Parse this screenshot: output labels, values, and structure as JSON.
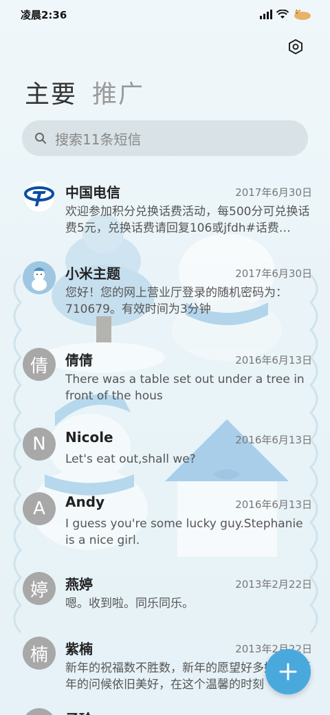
{
  "status_bar": {
    "time": "凌晨2:36"
  },
  "tabs": [
    {
      "label": "主要",
      "active": true
    },
    {
      "label": "推广",
      "active": false
    }
  ],
  "search": {
    "placeholder": "搜索11条短信"
  },
  "conversations": [
    {
      "name": "中国电信",
      "date": "2017年6月30日",
      "preview": "欢迎参加积分兑换话费活动，每500分可兑换话费5元，兑换话费请回复106或jfdh#话费…",
      "avatar_type": "logo",
      "avatar_icon": "china-telecom-logo"
    },
    {
      "name": "小米主题",
      "date": "2017年6月30日",
      "preview": "您好！您的网上营业厅登录的随机密码为：710679。有效时间为3分钟",
      "avatar_type": "image",
      "avatar_icon": "snowman-avatar"
    },
    {
      "name": "倩倩",
      "date": "2016年6月13日",
      "preview": "There was a table set out under a tree in front of the hous",
      "avatar_type": "letter",
      "avatar_letter": "倩"
    },
    {
      "name": "Nicole",
      "date": "2016年6月13日",
      "preview": "Let's eat out,shall we?",
      "avatar_type": "letter",
      "avatar_letter": "N"
    },
    {
      "name": "Andy",
      "date": "2016年6月13日",
      "preview": "I guess you're some lucky guy.Stephanie is a nice girl.",
      "avatar_type": "letter",
      "avatar_letter": "A"
    },
    {
      "name": "燕婷",
      "date": "2013年2月22日",
      "preview": "嗯。收到啦。同乐同乐。",
      "avatar_type": "letter",
      "avatar_letter": "婷"
    },
    {
      "name": "紫楠",
      "date": "2013年2月22日",
      "preview": "新年的祝福数不胜数，新年的愿望好多好多，新年的问候依旧美好，在这个温馨的时刻",
      "avatar_type": "letter",
      "avatar_letter": "楠"
    },
    {
      "name": "子玲",
      "date": "",
      "preview": "",
      "avatar_type": "letter",
      "avatar_letter": ""
    }
  ],
  "colors": {
    "accent": "#4aa9dc",
    "avatar_gray": "#a8a8a8",
    "telecom_blue": "#0b4ea2"
  },
  "icons": {
    "settings": "settings-hexagon-icon",
    "search": "search-icon",
    "fab": "plus-icon"
  }
}
